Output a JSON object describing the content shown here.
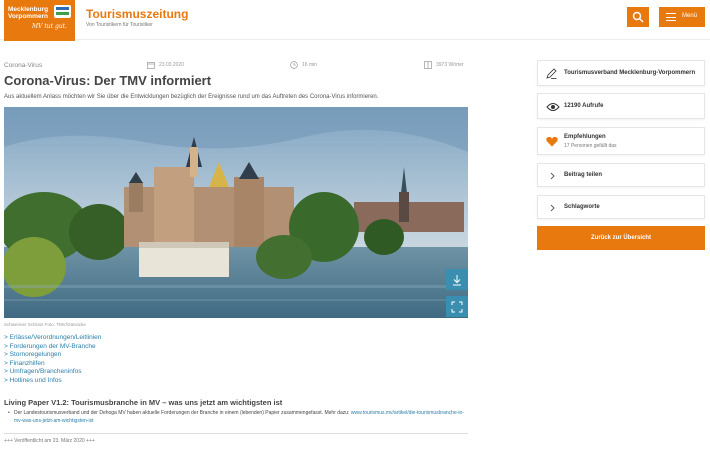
{
  "header": {
    "logo_line1": "Mecklenburg",
    "logo_line2": "Vorpommern",
    "logo_slogan": "MV tut gut.",
    "title": "Tourismuszeitung",
    "subtitle": "Von Touristikern für Touristiker",
    "menu_label": "Menü",
    "accent_color": "#e8790f"
  },
  "article": {
    "category": "Corona-Virus",
    "date": "23.03.2020",
    "read_time": "16 min",
    "word_count": "3973 Wörter",
    "headline": "Corona-Virus: Der TMV informiert",
    "intro": "Aus aktuellem Anlass möchten wir Sie über die Entwicklungen bezüglich der Ereignisse rund um das Auftreten des Corona-Virus informieren.",
    "image_caption": "Schweriner Schloss Foto: TMV/Gänsicke",
    "links": [
      {
        "prefix": "> ",
        "label": "Erlässe/Verordnungen/Leitlinien"
      },
      {
        "prefix": "> ",
        "label": "Forderungen der MV-Branche"
      },
      {
        "prefix": "> ",
        "label": "Stornoregelungen"
      },
      {
        "prefix": "> ",
        "label": "Finanzhilfen"
      },
      {
        "prefix": "> ",
        "label": "Umfragen/Brancheninfos"
      },
      {
        "prefix": "> ",
        "label": "Hotlines und Infos"
      }
    ],
    "section_title": "Living Paper V1.2: Tourismusbranche in MV – was uns jetzt am wichtigsten ist",
    "section_bullet": "•",
    "section_text": "Der Landestourismusverband und der Dehoga MV haben aktuelle Forderungen der Branche in einem (lebenden) Papier zusammengefasst. Mehr dazu:",
    "section_link": "www.tourismus.mv/artikel/die-tourismusbranche-in-mv-was-uns-jetzt-am-wichtigsten-ist",
    "published": "+++ Veröffentlicht am 23. März 2020 +++"
  },
  "sidebar": {
    "author": "Tourismusverband Mecklenburg-Vorpommern",
    "views": "12190 Aufrufe",
    "recommend_title": "Empfehlungen",
    "recommend_sub": "17 Personen gefällt das",
    "share": "Beitrag teilen",
    "tags": "Schlagworte",
    "back_button": "Zurück zur Übersicht"
  }
}
